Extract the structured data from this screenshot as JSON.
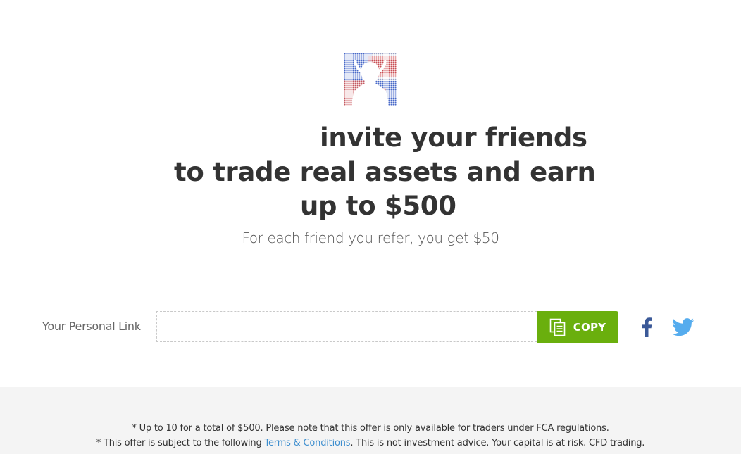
{
  "hero": {
    "avatar_icon": "user-avatar-icon",
    "headline_line1": "invite your friends",
    "headline_line2": "to trade real assets and earn",
    "headline_line3": "up to $500",
    "subtitle": "For each friend you refer, you get $50"
  },
  "share": {
    "label": "Your Personal Link",
    "link_value": "",
    "copy_label": "COPY",
    "copy_icon": "copy-icon",
    "facebook_icon": "facebook-icon",
    "twitter_icon": "twitter-icon"
  },
  "footer": {
    "note1": "* Up to 10 for a total of $500. Please note that this offer is only available for traders under FCA regulations.",
    "note2_prefix": "* This offer is subject to the following ",
    "terms_link": "Terms & Conditions",
    "note2_suffix": ". This is not investment advice. Your capital is at risk. CFD trading."
  },
  "colors": {
    "accent_green": "#6aaf0d",
    "facebook_blue": "#3b5998",
    "twitter_blue": "#55acee",
    "link_blue": "#3f8fcf",
    "headline": "#333333",
    "footer_bg": "#f4f4f4"
  }
}
